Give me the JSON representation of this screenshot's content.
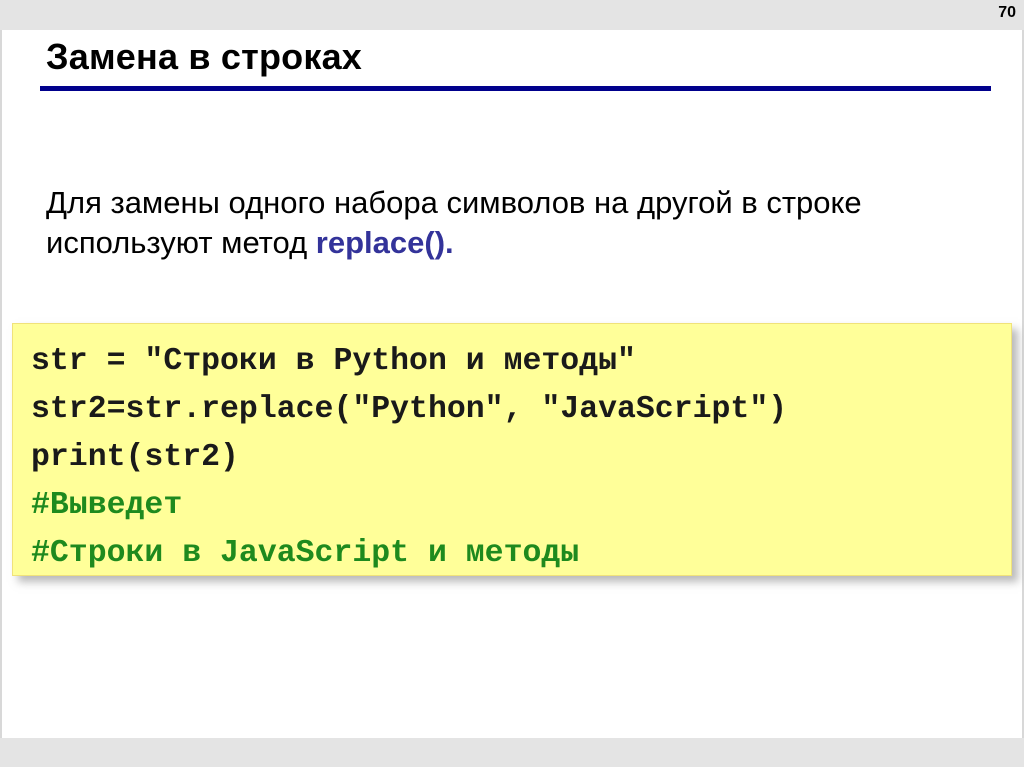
{
  "slide": {
    "page_number": "70",
    "title": "Замена в строках",
    "intro": {
      "text": "Для замены одного набора символов на другой в строке используют метод ",
      "method": "replace()."
    },
    "code": [
      {
        "text": "str = \"Строки в Python и методы\"",
        "kind": "code"
      },
      {
        "text": "str2=str.replace(\"Python\", \"JavaScript\")",
        "kind": "code"
      },
      {
        "text": "print(str2)",
        "kind": "code"
      },
      {
        "text": "#Выведет",
        "kind": "comment"
      },
      {
        "text": "#Строки в JavaScript и методы",
        "kind": "comment"
      }
    ]
  },
  "colors": {
    "title_rule": "#00008c",
    "method_highlight": "#33339a",
    "code_background": "#ffff99",
    "comment_text": "#1e8a1e",
    "frame_bars": "#e4e4e4"
  }
}
